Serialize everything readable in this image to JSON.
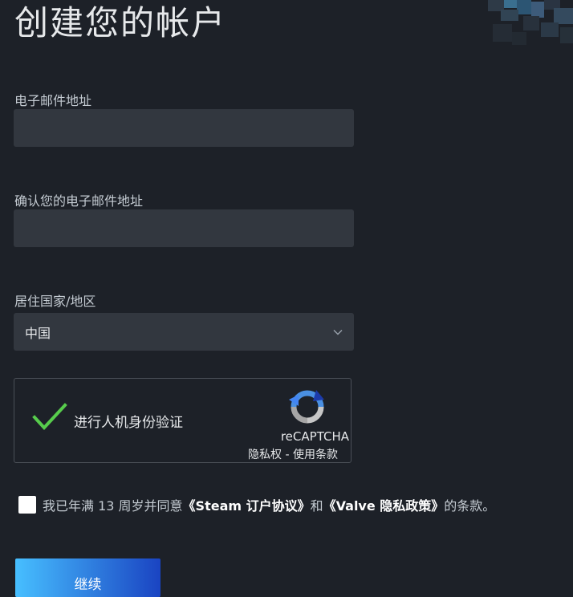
{
  "page": {
    "title": "创建您的帐户"
  },
  "form": {
    "email_label": "电子邮件地址",
    "email_value": "",
    "confirm_email_label": "确认您的电子邮件地址",
    "confirm_email_value": "",
    "country_label": "居住国家/地区",
    "country_selected": "中国"
  },
  "recaptcha": {
    "label": "进行人机身份验证",
    "brand": "reCAPTCHA",
    "privacy_link": "隐私权",
    "separator": " - ",
    "terms_link": "使用条款"
  },
  "agreement": {
    "prefix": "我已年满 13 周岁并同意",
    "ssa_link": "《Steam 订户协议》",
    "middle": "和",
    "privacy_link": "《Valve 隐私政策》",
    "suffix": "的条款。"
  },
  "continue_label": "继续",
  "colors": {
    "background": "#1d2128",
    "input_background": "#32373f",
    "check_green": "#57cc4c",
    "button_gradient_start": "#47bfff",
    "button_gradient_end": "#1a44c2"
  },
  "icons": {
    "select_arrow": "chevron-down-icon",
    "recaptcha_check": "checkmark-icon",
    "recaptcha_logo": "recaptcha-logo-icon"
  }
}
